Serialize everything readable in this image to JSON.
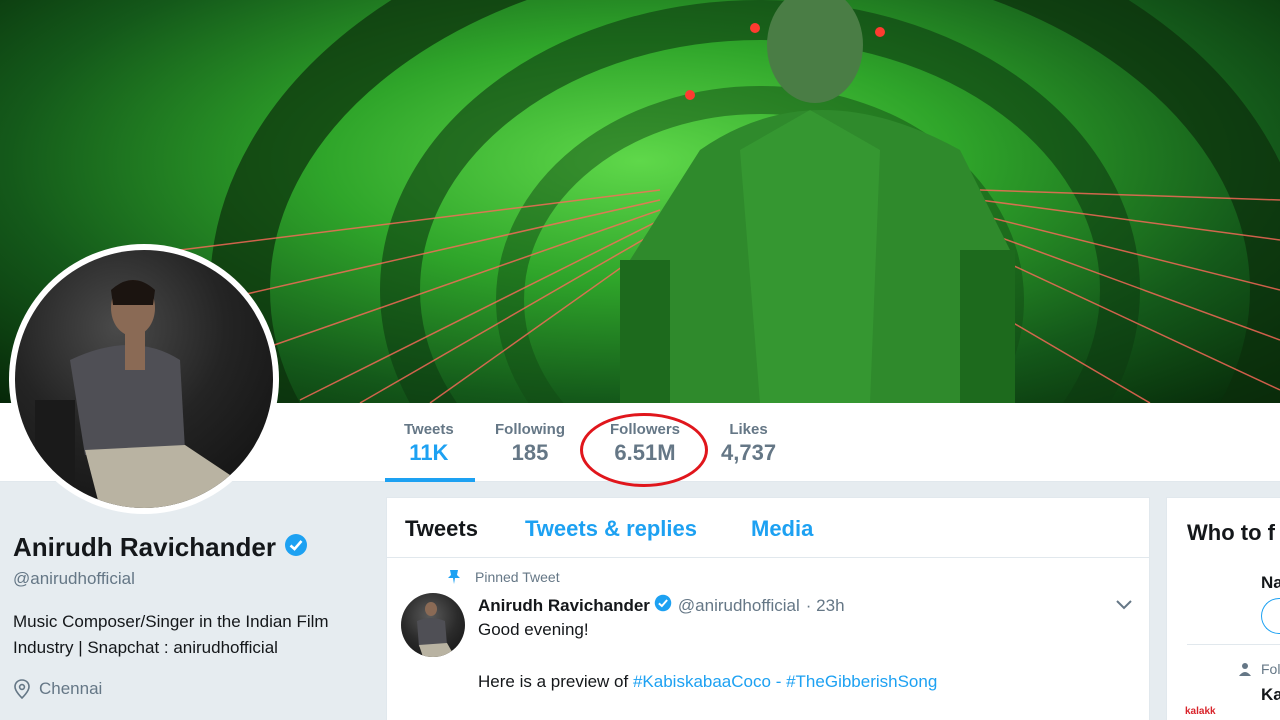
{
  "stats": {
    "tweets": {
      "label": "Tweets",
      "value": "11K"
    },
    "following": {
      "label": "Following",
      "value": "185"
    },
    "followers": {
      "label": "Followers",
      "value": "6.51M"
    },
    "likes": {
      "label": "Likes",
      "value": "4,737"
    }
  },
  "profile": {
    "name": "Anirudh Ravichander",
    "handle": "@anirudhofficial",
    "bio_line1": "Music Composer/Singer in the Indian Film",
    "bio_line2": "Industry | Snapchat : anirudhofficial",
    "location": "Chennai"
  },
  "timeline": {
    "tabs": [
      {
        "label": "Tweets"
      },
      {
        "label": "Tweets & replies"
      },
      {
        "label": "Media"
      }
    ],
    "pinned_label": "Pinned Tweet",
    "tweet": {
      "name": "Anirudh Ravichander",
      "handle": "@anirudhofficial",
      "time": "· 23h",
      "text1": "Good evening!",
      "text2_prefix": "Here is a preview of",
      "hashtag1": "#KabiskabaaCoco",
      "separator": "-",
      "hashtag2": "#TheGibberishSong"
    }
  },
  "right_panel": {
    "title": "Who to f",
    "suggestion1_name": "Na",
    "followed_label": "Fol",
    "suggestion2_name": "Ka",
    "logo_text": "kalakk"
  },
  "colors": {
    "accent": "#1da1f2",
    "highlight": "#e0161c",
    "muted": "#657786"
  }
}
